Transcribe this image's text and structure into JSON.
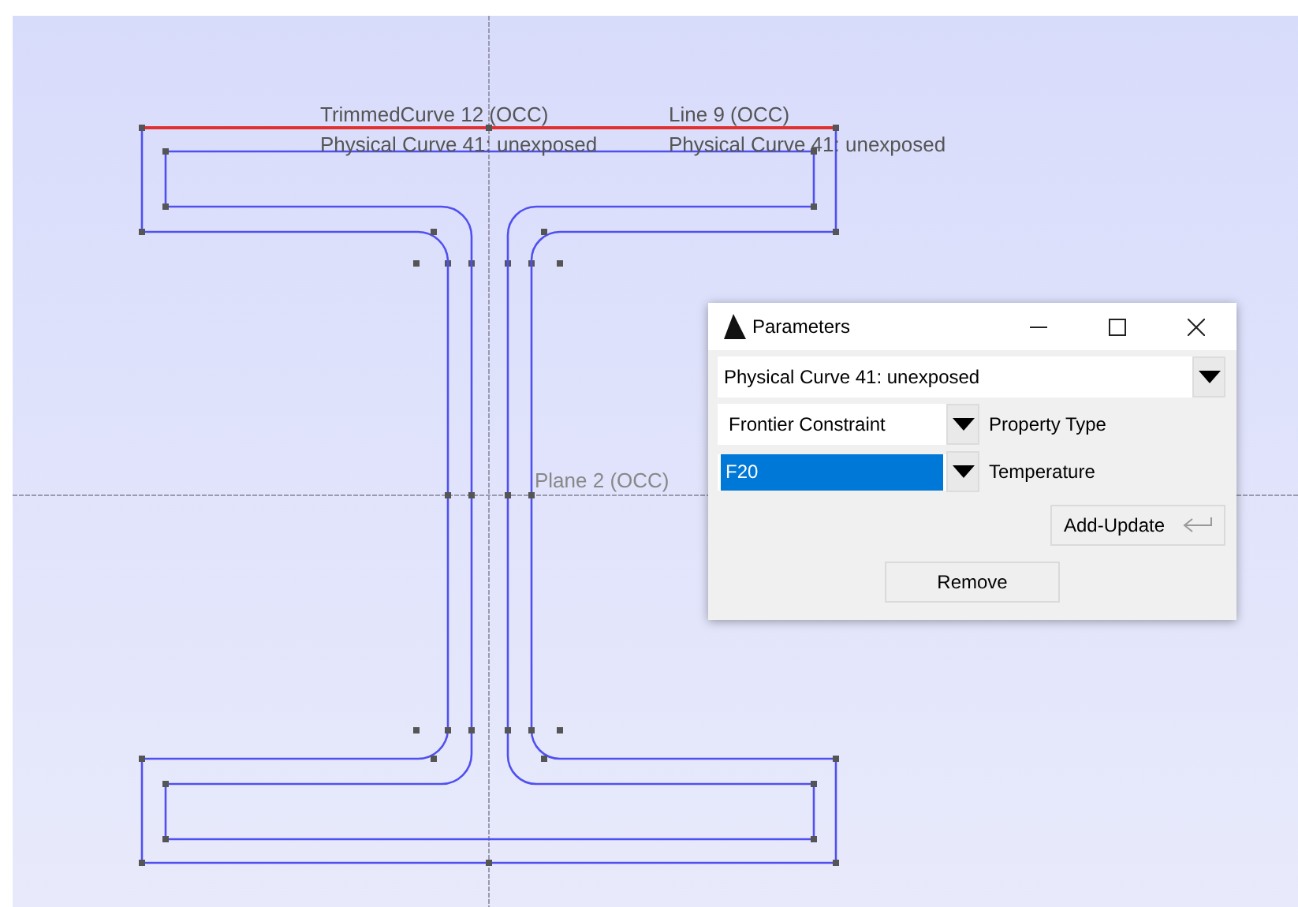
{
  "canvas": {
    "labels": [
      {
        "text": "TrimmedCurve 12 (OCC)"
      },
      {
        "text": "Line 9 (OCC)"
      },
      {
        "text": "Physical Curve 41: unexposed"
      },
      {
        "text": "Physical Curve 41: unexposed"
      },
      {
        "text": "Plane 2 (OCC)"
      }
    ]
  },
  "dialog": {
    "title": "Parameters",
    "group_select": {
      "value": "Physical Curve 41: unexposed"
    },
    "fields": [
      {
        "kind": "choice",
        "value": "Frontier Constraint",
        "label": "Property Type",
        "selected": false
      },
      {
        "kind": "input",
        "value": "F20",
        "label": "Temperature",
        "selected": true
      }
    ],
    "buttons": [
      {
        "kind": "return",
        "label": "Add-Update"
      },
      {
        "kind": "plain",
        "label": "Remove"
      }
    ]
  }
}
